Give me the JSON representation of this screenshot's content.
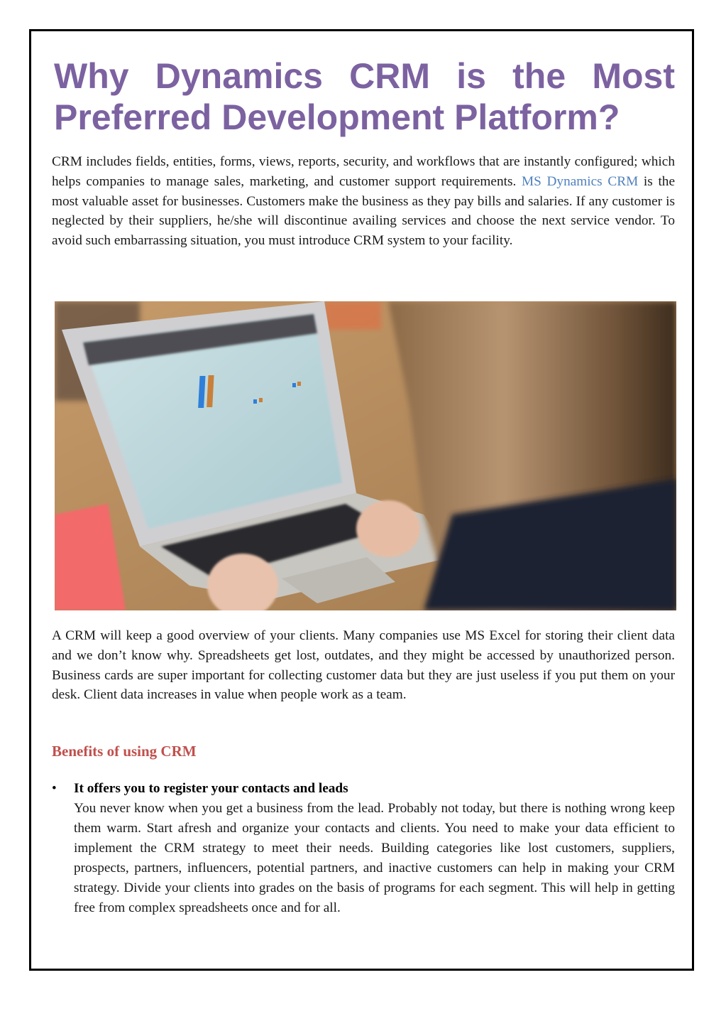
{
  "article": {
    "title_line1": "Why Dynamics CRM is the Most",
    "title_line2": "Preferred Development Platform?",
    "intro": {
      "before_link": "CRM includes fields, entities, forms, views, reports, security, and workflows that are instantly configured; which helps companies to manage sales, marketing, and customer support requirements. ",
      "link_text": "MS Dynamics CRM",
      "after_link": " is the most valuable asset for businesses. Customers make the business as they pay bills and salaries. If any customer is neglected by their suppliers, he/she will discontinue availing services and choose the next service vendor. To avoid such embarrassing situation, you must introduce CRM system to your facility."
    },
    "image": {
      "description": "Person typing on a laptop showing a CRM dashboard with bar chart, pink phone on desk"
    },
    "paragraph2": "A CRM will keep a good overview of your clients. Many companies use MS Excel for storing their client data and we don’t know why. Spreadsheets get lost, outdates, and they might be accessed by unauthorized person. Business cards are super important for collecting customer data but they are just useless if you put them on your desk. Client data increases in value when people work as a team.",
    "benefits_heading": "Benefits of using CRM",
    "bullets": [
      {
        "marker": "•",
        "heading": "It offers you to register your contacts and leads",
        "body": "You never know when you get a business from the lead. Probably not today, but there is nothing wrong keep them warm. Start afresh and organize your contacts and clients. You need to make your data efficient to implement the CRM strategy to meet their needs. Building categories like lost customers, suppliers, prospects, partners, influencers, potential partners, and inactive customers can help in making your CRM strategy. Divide your clients into grades on the basis of programs for each segment. This will help in getting free from complex spreadsheets once and for all."
      }
    ]
  },
  "colors": {
    "title": "#7c62a1",
    "link": "#4f81bd",
    "subheading": "#c0504d",
    "border": "#000000"
  }
}
